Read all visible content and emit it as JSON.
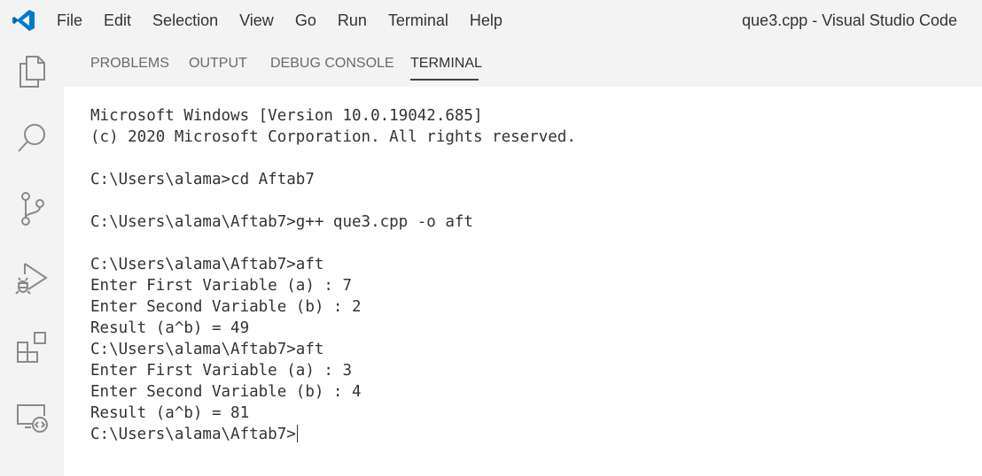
{
  "app": {
    "window_title": "que3.cpp - Visual Studio Code",
    "brand_color": "#007acc"
  },
  "menu": {
    "items": [
      "File",
      "Edit",
      "Selection",
      "View",
      "Go",
      "Run",
      "Terminal",
      "Help"
    ]
  },
  "activity_bar": {
    "icons": [
      "explorer-icon",
      "search-icon",
      "source-control-icon",
      "run-debug-icon",
      "extensions-icon",
      "remote-explorer-icon"
    ]
  },
  "panel": {
    "tabs": [
      "PROBLEMS",
      "OUTPUT",
      "DEBUG CONSOLE",
      "TERMINAL"
    ],
    "active_tab": "TERMINAL"
  },
  "terminal": {
    "lines": [
      "Microsoft Windows [Version 10.0.19042.685]",
      "(c) 2020 Microsoft Corporation. All rights reserved.",
      "",
      "C:\\Users\\alama>cd Aftab7",
      "",
      "C:\\Users\\alama\\Aftab7>g++ que3.cpp -o aft",
      "",
      "C:\\Users\\alama\\Aftab7>aft",
      "Enter First Variable (a) : 7",
      "Enter Second Variable (b) : 2",
      "Result (a^b) = 49",
      "C:\\Users\\alama\\Aftab7>aft",
      "Enter First Variable (a) : 3",
      "Enter Second Variable (b) : 4",
      "Result (a^b) = 81",
      "C:\\Users\\alama\\Aftab7>"
    ]
  }
}
